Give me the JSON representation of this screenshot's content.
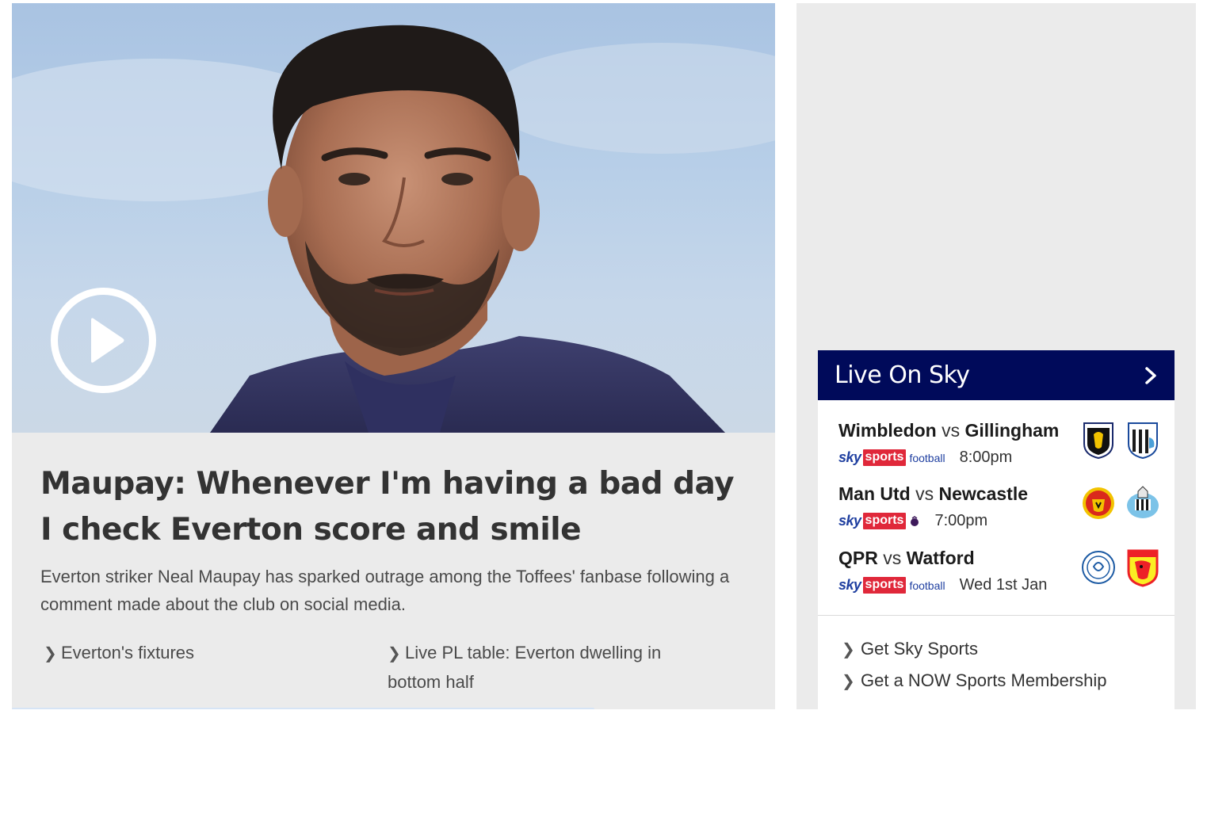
{
  "story": {
    "headline": "Maupay: Whenever I'm having a bad day I check Everton score and smile",
    "standfirst": "Everton striker Neal Maupay has sparked outrage among the Toffees' fanbase following a comment made about the club on social media.",
    "related": [
      {
        "label": "Everton's fixtures"
      },
      {
        "label": "Live PL table: Everton dwelling in bottom half"
      }
    ]
  },
  "live_on_sky": {
    "title": "Live On Sky",
    "matches": [
      {
        "home": "Wimbledon",
        "vs": "vs",
        "away": "Gillingham",
        "brand_sky": "sky",
        "brand_sports": "sports",
        "channel": "football",
        "time": "8:00pm",
        "home_crest": "wimbledon-crest",
        "away_crest": "gillingham-crest"
      },
      {
        "home": "Man Utd",
        "vs": "vs",
        "away": "Newcastle",
        "brand_sky": "sky",
        "brand_sports": "sports",
        "channel": "",
        "time": "7:00pm",
        "home_crest": "man-utd-crest",
        "away_crest": "newcastle-crest"
      },
      {
        "home": "QPR",
        "vs": "vs",
        "away": "Watford",
        "brand_sky": "sky",
        "brand_sports": "sports",
        "channel": "football",
        "time": "Wed 1st Jan",
        "home_crest": "qpr-crest",
        "away_crest": "watford-crest"
      }
    ],
    "links": [
      {
        "label": "Get Sky Sports"
      },
      {
        "label": "Get a NOW Sports Membership"
      }
    ]
  },
  "colors": {
    "header_navy": "#000a5a",
    "sky_blue": "#1f3fa0",
    "sports_red": "#e0283a",
    "card_grey": "#ebebeb"
  }
}
